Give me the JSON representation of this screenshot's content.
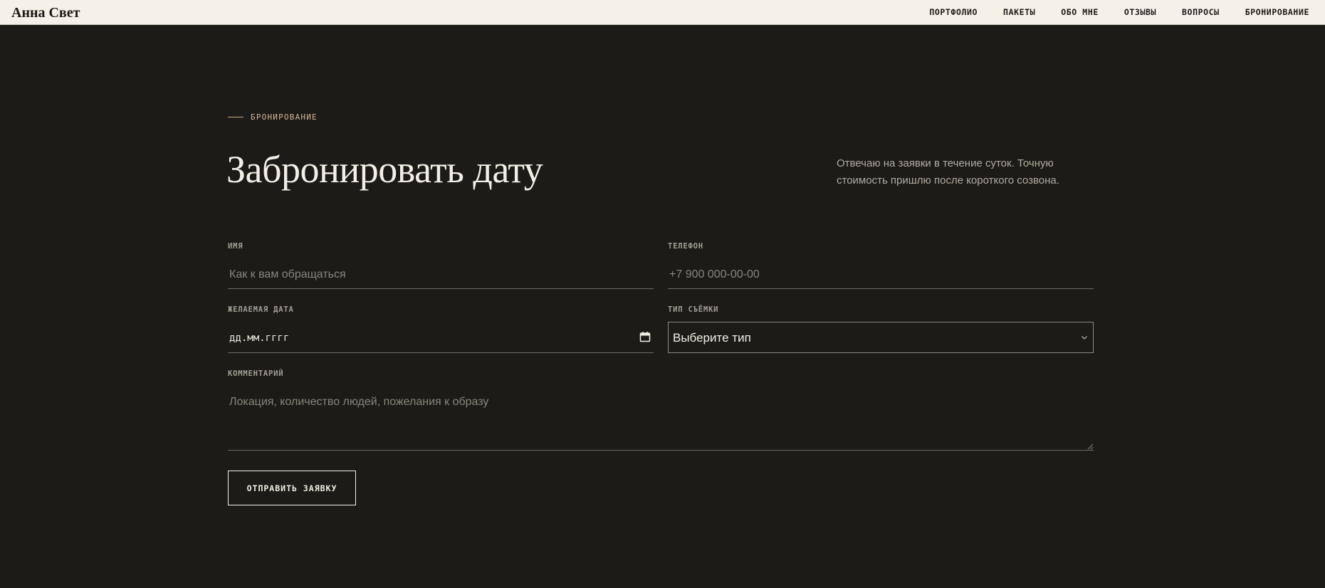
{
  "brand": "Анна Свет",
  "nav": [
    "ПОРТФОЛИО",
    "ПАКЕТЫ",
    "ОБО МНЕ",
    "ОТЗЫВЫ",
    "ВОПРОСЫ",
    "БРОНИРОВАНИЕ"
  ],
  "section": {
    "eyebrow": "БРОНИРОВАНИЕ",
    "title": "Забронировать дату",
    "intro": "Отвечаю на заявки в течение суток. Точную стоимость пришлю после короткого созвона."
  },
  "form": {
    "name": {
      "label": "ИМЯ",
      "placeholder": "Как к вам обращаться"
    },
    "phone": {
      "label": "ТЕЛЕФОН",
      "placeholder": "+7 900 000-00-00"
    },
    "date": {
      "label": "ЖЕЛАЕМАЯ ДАТА",
      "value": "дд.мм.гггг",
      "icon": "calendar-icon"
    },
    "type": {
      "label": "ТИП СЪЁМКИ",
      "value": "Выберите тип",
      "icon": "chevron-down-icon"
    },
    "comment": {
      "label": "КОММЕНТАРИЙ",
      "placeholder": "Локация, количество людей, пожелания к образу"
    },
    "submit": "ОТПРАВИТЬ ЗАЯВКУ"
  },
  "colors": {
    "background": "#1c1b17",
    "header": "#f5f1e8",
    "accent": "#d4b595",
    "text": "#f3efe6"
  }
}
